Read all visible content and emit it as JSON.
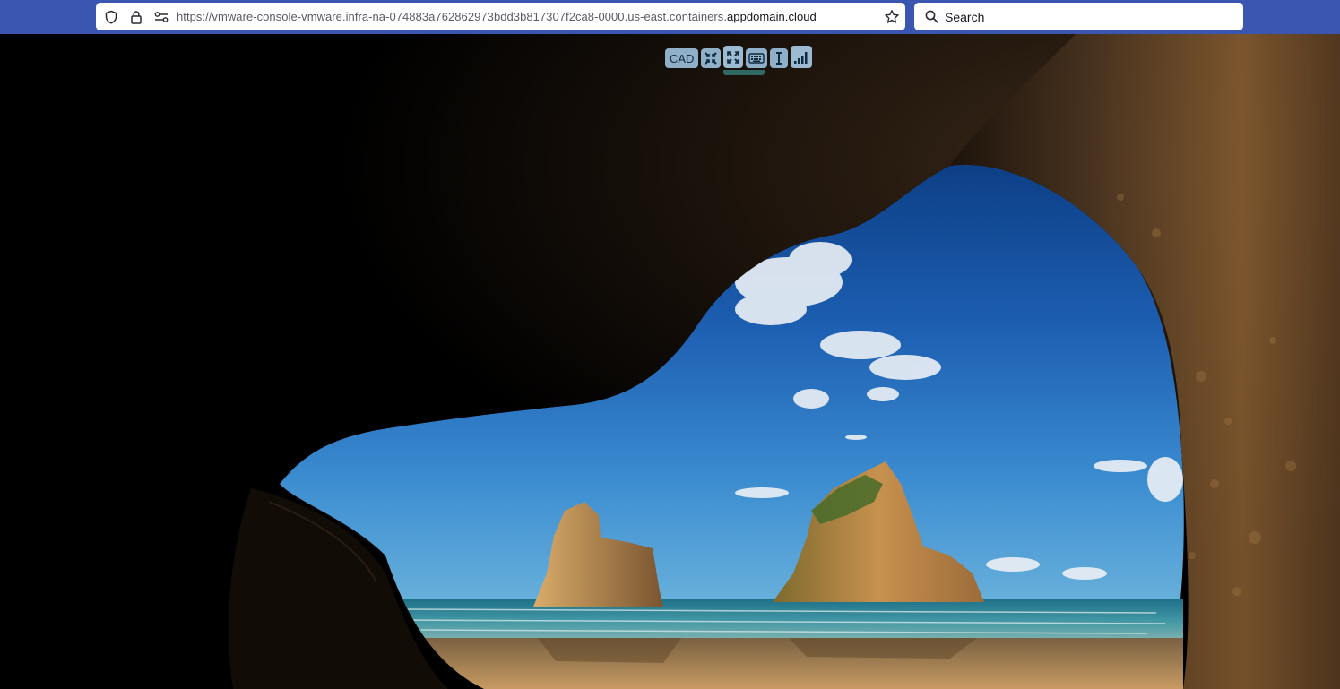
{
  "browser": {
    "url_prefix": "https://vmware-console-vmware.infra-na-074883a762862973bdd3b817307f2ca8-0000.us-east.containers.",
    "url_domain": "appdomain.cloud",
    "search_placeholder": "Search",
    "icons": [
      "shield-icon",
      "lock-icon",
      "permissions-icon",
      "bookmark-star-icon",
      "search-icon"
    ]
  },
  "console_toolbar": {
    "cad_label": "CAD",
    "buttons": [
      "fit-to-window-icon",
      "fullscreen-icon",
      "keyboard-icon",
      "cursor-icon",
      "connection-quality-icon"
    ]
  },
  "colors": {
    "browser_bar": "#3a56b0",
    "toolbar_button": "#8fb0c8",
    "sky": "#2a71c4",
    "sea": "#2f8e9a"
  }
}
